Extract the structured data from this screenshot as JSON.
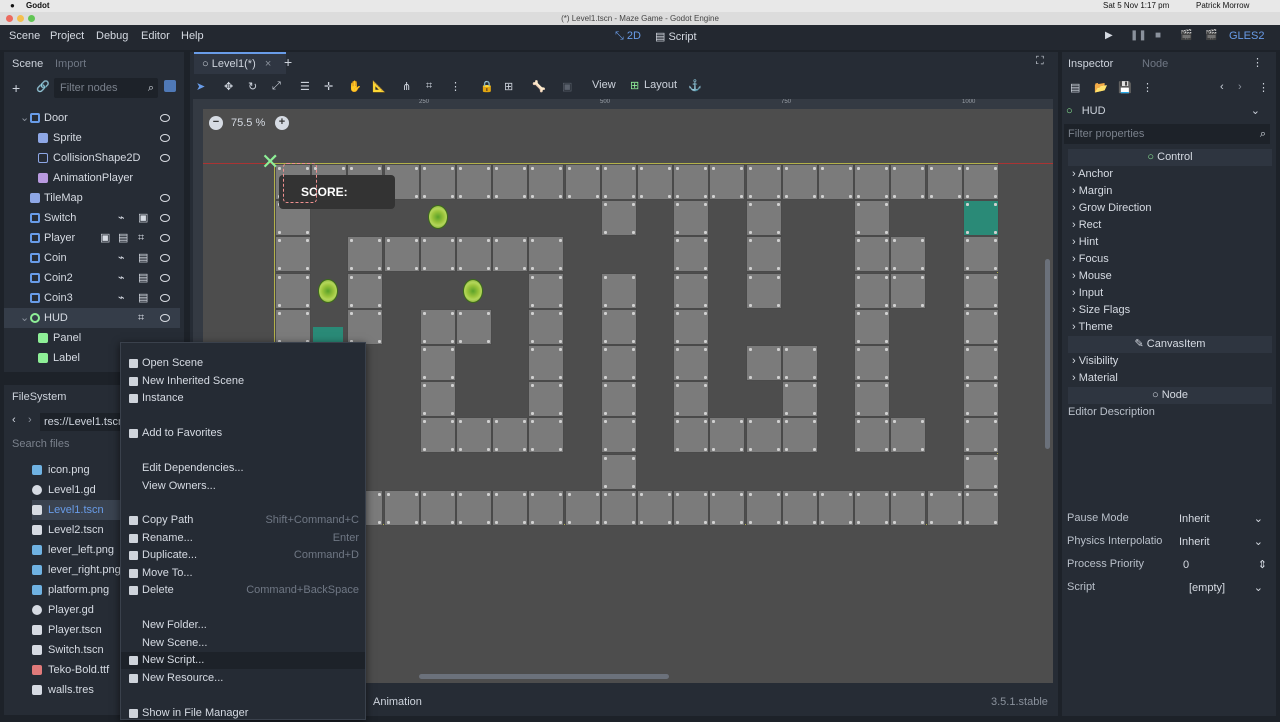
{
  "os_menubar": {
    "app": "Godot",
    "datetime": "Sat 5 Nov  1:17 pm",
    "user": "Patrick Morrow"
  },
  "window_title": "(*) Level1.tscn - Maze Game - Godot Engine",
  "main_menu": [
    "Scene",
    "Project",
    "Debug",
    "Editor",
    "Help"
  ],
  "workspaces": {
    "mode_2d": "2D",
    "script": "Script"
  },
  "renderer": "GLES2",
  "scene_dock": {
    "tabs": [
      "Scene",
      "Import"
    ],
    "filter_placeholder": "Filter nodes",
    "nodes": [
      {
        "label": "Door",
        "icon": "area2d-icon"
      },
      {
        "label": "Sprite",
        "icon": "sprite-icon"
      },
      {
        "label": "CollisionShape2D",
        "icon": "collision-icon"
      },
      {
        "label": "AnimationPlayer",
        "icon": "animation-icon"
      },
      {
        "label": "TileMap",
        "icon": "tilemap-icon"
      },
      {
        "label": "Switch",
        "icon": "area2d-icon"
      },
      {
        "label": "Player",
        "icon": "kinematic-icon"
      },
      {
        "label": "Coin",
        "icon": "area2d-icon"
      },
      {
        "label": "Coin2",
        "icon": "area2d-icon"
      },
      {
        "label": "Coin3",
        "icon": "area2d-icon"
      },
      {
        "label": "HUD",
        "icon": "canvaslayer-icon"
      },
      {
        "label": "Panel",
        "icon": "panel-icon"
      },
      {
        "label": "Label",
        "icon": "label-icon"
      }
    ]
  },
  "filesystem_dock": {
    "title": "FileSystem",
    "path": "res://Level1.tscn",
    "search_placeholder": "Search files",
    "files": [
      "icon.png",
      "Level1.gd",
      "Level1.tscn",
      "Level2.tscn",
      "lever_left.png",
      "lever_right.png",
      "platform.png",
      "Player.gd",
      "Player.tscn",
      "Switch.tscn",
      "Teko-Bold.ttf",
      "walls.tres"
    ]
  },
  "context_menu": {
    "items": [
      {
        "label": "Open Scene",
        "shortcut": ""
      },
      {
        "label": "New Inherited Scene",
        "shortcut": ""
      },
      {
        "label": "Instance",
        "shortcut": ""
      },
      {
        "label": "Add to Favorites",
        "shortcut": ""
      },
      {
        "label": "Edit Dependencies...",
        "shortcut": ""
      },
      {
        "label": "View Owners...",
        "shortcut": ""
      },
      {
        "label": "Copy Path",
        "shortcut": "Shift+Command+C"
      },
      {
        "label": "Rename...",
        "shortcut": "Enter"
      },
      {
        "label": "Duplicate...",
        "shortcut": "Command+D"
      },
      {
        "label": "Move To...",
        "shortcut": ""
      },
      {
        "label": "Delete",
        "shortcut": "Command+BackSpace"
      },
      {
        "label": "New Folder...",
        "shortcut": ""
      },
      {
        "label": "New Scene...",
        "shortcut": ""
      },
      {
        "label": "New Script...",
        "shortcut": ""
      },
      {
        "label": "New Resource...",
        "shortcut": ""
      },
      {
        "label": "Show in File Manager",
        "shortcut": ""
      }
    ]
  },
  "editor": {
    "tab_label": "Level1(*)",
    "toolbar": {
      "view": "View",
      "layout": "Layout"
    },
    "zoom": "75.5 %",
    "ruler_ticks": [
      "250",
      "500",
      "750",
      "1000",
      "1250"
    ],
    "hud_label": "SCORE:",
    "bottom_tab": "Animation",
    "version": "3.5.1.stable"
  },
  "inspector": {
    "tabs": [
      "Inspector",
      "Node"
    ],
    "node_name": "HUD",
    "filter_placeholder": "Filter properties",
    "section_control": "Control",
    "control_props": [
      "Anchor",
      "Margin",
      "Grow Direction",
      "Rect",
      "Hint",
      "Focus",
      "Mouse",
      "Input",
      "Size Flags",
      "Theme"
    ],
    "section_canvasitem": "CanvasItem",
    "canvas_props": [
      "Visibility",
      "Material"
    ],
    "section_node": "Node",
    "editor_description": "Editor Description",
    "properties": [
      {
        "name": "Pause Mode",
        "value": "Inherit"
      },
      {
        "name": "Physics Interpolatio",
        "value": "Inherit"
      },
      {
        "name": "Process Priority",
        "value": "0"
      },
      {
        "name": "Script",
        "value": "[empty]"
      }
    ]
  },
  "colors": {
    "accent": "#699ce8",
    "canvas_bg": "#4d4d4d",
    "tile": "#7b7b7b",
    "door": "#2a8a77"
  }
}
